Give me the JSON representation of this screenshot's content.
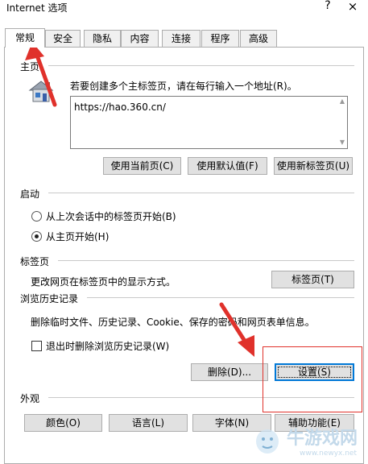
{
  "window": {
    "title": "Internet 选项",
    "help_glyph": "?",
    "close_glyph": "×"
  },
  "tabs": [
    {
      "label": "常规",
      "active": true
    },
    {
      "label": "安全"
    },
    {
      "label": "隐私"
    },
    {
      "label": "内容"
    },
    {
      "label": "连接"
    },
    {
      "label": "程序"
    },
    {
      "label": "高级"
    }
  ],
  "home": {
    "heading": "主页",
    "instruction": "若要创建多个主标签页，请在每行输入一个地址(R)。",
    "url_value": "https://hao.360.cn/",
    "buttons": {
      "current": "使用当前页(C)",
      "default": "使用默认值(F)",
      "new_tab": "使用新标签页(U)"
    },
    "icon": "house-icon"
  },
  "startup": {
    "heading": "启动",
    "option_last_session": "从上次会话中的标签页开始(B)",
    "option_home": "从主页开始(H)",
    "selected": "option_home"
  },
  "tabs_section": {
    "heading": "标签页",
    "description": "更改网页在标签页中的显示方式。",
    "button": "标签页(T)"
  },
  "history": {
    "heading": "浏览历史记录",
    "description": "删除临时文件、历史记录、Cookie、保存的密码和网页表单信息。",
    "checkbox_label": "退出时删除浏览历史记录(W)",
    "checkbox_checked": false,
    "delete_button": "删除(D)...",
    "settings_button": "设置(S)"
  },
  "appearance": {
    "heading": "外观",
    "buttons": {
      "colors": "颜色(O)",
      "languages": "语言(L)",
      "fonts": "字体(N)",
      "accessibility": "辅助功能(E)"
    }
  },
  "watermark": {
    "text_cn": "牛游戏网",
    "text_url": "www.newyx.net"
  },
  "colors": {
    "annotation_red": "#e0312b",
    "button_face": "#e1e1e1",
    "default_border": "#0078d7"
  }
}
